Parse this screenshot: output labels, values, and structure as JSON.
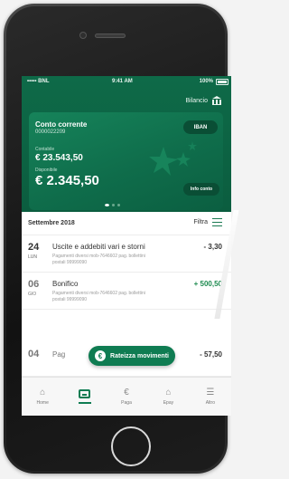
{
  "status_bar": {
    "carrier": "••••• BNL",
    "time": "9:41 AM",
    "battery": "100%"
  },
  "header": {
    "bilancio_label": "Bilancio",
    "bilancio_icon": "bank-icon"
  },
  "account_card": {
    "title": "Conto corrente",
    "number": "0000022209",
    "iban_label": "IBAN",
    "contabile_label": "Contabile",
    "contabile_amount": "€ 23.543,50",
    "disponibile_label": "Disponibile",
    "disponibile_amount": "€ 2.345,50",
    "info_label": "Info conto",
    "page_dots": 3,
    "active_dot": 1
  },
  "list": {
    "month": "Settembre 2018",
    "filter_label": "Filtra"
  },
  "transactions": [
    {
      "day": "24",
      "weekday": "LUN",
      "title": "Uscite e addebiti vari e storni",
      "subtitle": "Pagamenti diversi mob-7646602 pag. bollettini postali 99999090",
      "amount": "- 3,30",
      "positive": false
    },
    {
      "day": "06",
      "weekday": "GIO",
      "title": "Bonifico",
      "subtitle": "Pagamenti diversi mob-7646602 pag. bollettini postali 99999090",
      "amount": "+ 500,50",
      "positive": true
    },
    {
      "day": "04",
      "weekday": "",
      "title": "Pag",
      "subtitle": "",
      "amount": "- 57,50",
      "positive": false
    }
  ],
  "fab": {
    "label": "Rateizza movimenti",
    "icon": "euro-refresh-icon"
  },
  "tabbar": [
    {
      "label": "Home",
      "icon": "home-icon",
      "active": false
    },
    {
      "label": "",
      "icon": "wallet-icon",
      "active": true
    },
    {
      "label": "Paga",
      "icon": "euro-icon",
      "active": false
    },
    {
      "label": "Epay",
      "icon": "shop-icon",
      "active": false
    },
    {
      "label": "Altro",
      "icon": "menu-icon",
      "active": false
    }
  ],
  "colors": {
    "brand_green": "#0f7c52",
    "dark_green": "#0b5d3f",
    "positive_amount": "#1d8a4f"
  }
}
